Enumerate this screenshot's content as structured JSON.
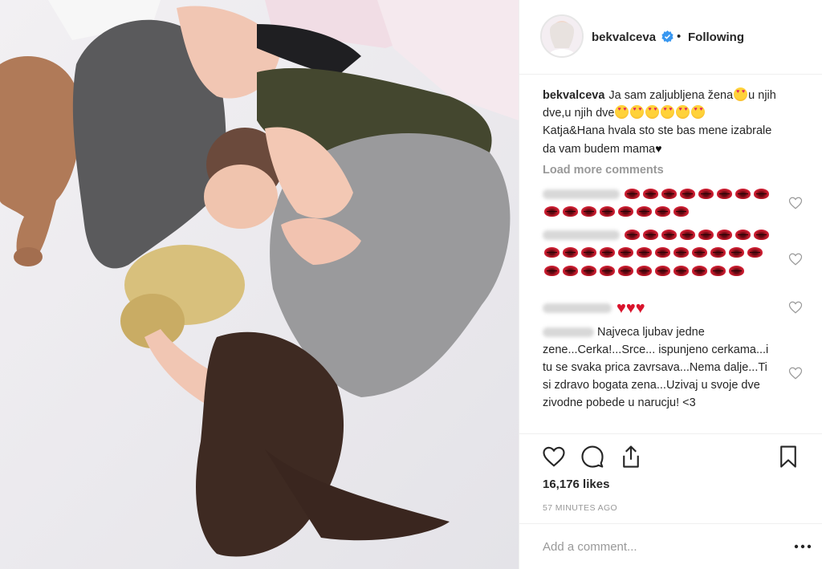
{
  "post": {
    "username": "bekvalceva",
    "separator": "•",
    "follow_status": "Following",
    "verified": true
  },
  "caption": {
    "username": "bekvalceva",
    "line1": "Ja sam zaljubljena žena",
    "line2": "u njih dve,u njih dve",
    "line3": "Katja&Hana hvala sto ste bas mene izabrale da vam budem mama",
    "emoji": "heart-eyes-emoji",
    "end_emoji": "♥"
  },
  "load_more_label": "Load more comments",
  "comments": [
    {
      "username": "(blurred)",
      "lips_count": 16
    },
    {
      "username": "(blurred)",
      "lips_count": 31
    },
    {
      "username": "(blurred)",
      "hearts": "♥♥♥"
    },
    {
      "username": "(blurred)",
      "text": "Najveca ljubav jedne zene...Cerka!...Srce... ispunjeno cerkama...i tu se svaka prica zavrsava...Nema dalje...Ti si zdravo bogata zena...Uzivaj u svoje dve zivodne pobede u narucju! <3"
    }
  ],
  "likes": "16,176 likes",
  "time_ago": "57 MINUTES AGO",
  "add_comment_placeholder": "Add a comment...",
  "icons": {
    "like": "heart-outline-icon",
    "comment": "comment-bubble-icon",
    "share": "share-icon",
    "save": "bookmark-icon",
    "more": "more-dots-icon",
    "verified": "verified-badge-icon"
  },
  "colors": {
    "accent_blue": "#3897f0",
    "muted_text": "#999999",
    "border": "#efefef"
  }
}
